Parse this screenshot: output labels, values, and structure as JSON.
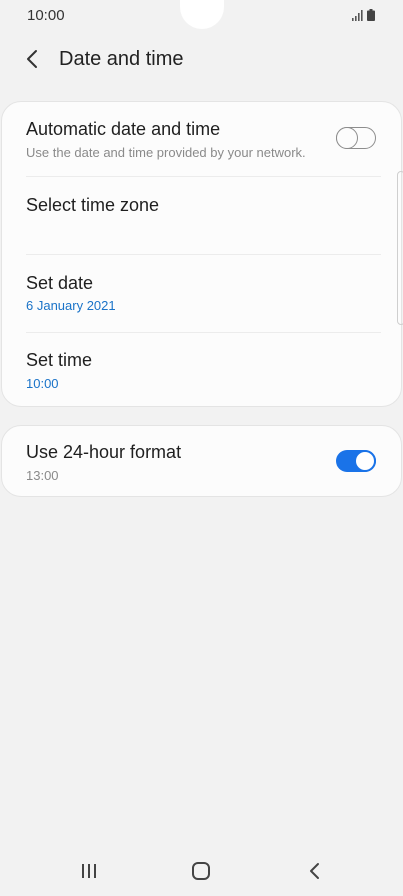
{
  "status_bar": {
    "time": "10:00",
    "icons": [
      "signal-icon",
      "battery-icon"
    ]
  },
  "header": {
    "back_icon": "chevron-left-icon",
    "title": "Date and time"
  },
  "settings_group_1": {
    "automatic": {
      "title": "Automatic date and time",
      "subtitle": "Use the date and time provided by your network.",
      "enabled": false
    },
    "time_zone": {
      "title": "Select time zone"
    },
    "date": {
      "title": "Set date",
      "value": "6 January 2021"
    },
    "time": {
      "title": "Set time",
      "value": "10:00"
    }
  },
  "settings_group_2": {
    "format_24h": {
      "title": "Use 24-hour format",
      "value": "13:00",
      "enabled": true
    }
  },
  "colors": {
    "accent": "#1a73e8",
    "background": "#f2f2f2",
    "card": "#fcfcfc"
  },
  "nav_bar": {
    "icons": [
      "recents-icon",
      "home-icon",
      "back-icon"
    ]
  }
}
